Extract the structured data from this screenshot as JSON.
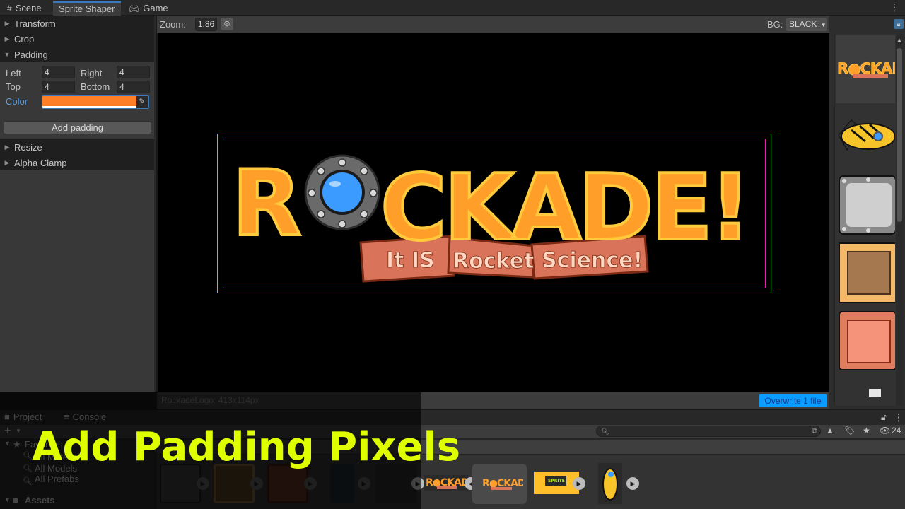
{
  "tabs": [
    {
      "label": "Scene",
      "icon": "grid-icon"
    },
    {
      "label": "Sprite Shaper",
      "active": true
    },
    {
      "label": "Game",
      "icon": "gamepad-icon"
    }
  ],
  "left_panel": {
    "sections": {
      "transform": "Transform",
      "crop": "Crop",
      "padding": "Padding",
      "resize": "Resize",
      "alpha_clamp": "Alpha Clamp"
    },
    "padding": {
      "left_label": "Left",
      "left_value": "4",
      "right_label": "Right",
      "right_value": "4",
      "top_label": "Top",
      "top_value": "4",
      "bottom_label": "Bottom",
      "bottom_value": "4",
      "color_label": "Color",
      "color_value": "#ff7f26",
      "add_button": "Add padding"
    }
  },
  "viewer": {
    "zoom_label": "Zoom:",
    "zoom_value": "1.86",
    "bg_label": "BG:",
    "bg_value": "BLACK",
    "logo": {
      "title": "ROCKADE!",
      "subtitle_parts": [
        "It IS",
        "Rocket",
        "Science!"
      ]
    },
    "status": "RockadeLogo: 413x114px",
    "overwrite_button": "Overwrite 1 file",
    "colors": {
      "outer_bounds": "#2ee66a",
      "inner_bounds": "#e61fb0",
      "accent": "#0b9cff"
    }
  },
  "right_thumbnails": [
    "rockade-logo",
    "yellow-fish-ship",
    "metal-panel",
    "wooden-crate",
    "red-wood-crate"
  ],
  "bottom": {
    "tabs": [
      {
        "label": "Project",
        "icon": "folder-icon"
      },
      {
        "label": "Console",
        "icon": "console-icon"
      }
    ],
    "add_button": "+",
    "tree": {
      "favorites": "Favorites",
      "items": [
        "All Materials",
        "All Models",
        "All Prefabs"
      ],
      "assets": "Assets"
    },
    "search_placeholder": "",
    "hidden_count": "24",
    "assets": [
      "dark-panel",
      "brown-crate",
      "red-crate",
      "dark-trees",
      "pixel-tiles",
      "rockade-logo-a",
      "rockade-logo-b",
      "sprite-shaper-banner",
      "yellow-rocket"
    ]
  },
  "caption": "Add Padding Pixels"
}
